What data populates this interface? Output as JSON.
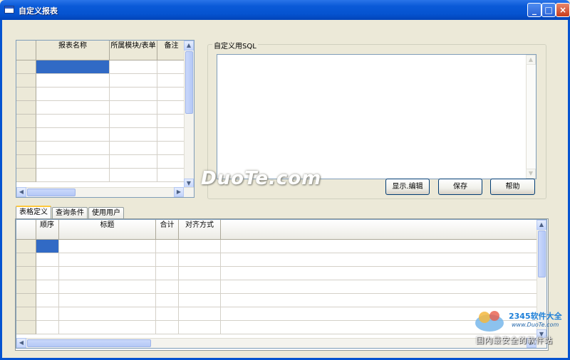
{
  "window": {
    "title": "自定义报表",
    "minimize": "_",
    "maximize": "□",
    "close": "×"
  },
  "top_grid": {
    "columns": [
      "报表名称",
      "所属模块/表单",
      "备注"
    ],
    "row_count": 9
  },
  "sql_group": {
    "legend": "自定义用SQL",
    "sql_text": ""
  },
  "buttons": {
    "display_edit": "显示.编辑",
    "save": "保存",
    "help": "帮助"
  },
  "tabs": [
    {
      "label": "表格定义",
      "active": true
    },
    {
      "label": "查询条件",
      "active": false
    },
    {
      "label": "使用用户",
      "active": false
    }
  ],
  "bottom_grid": {
    "columns": [
      "顺序",
      "标题",
      "合计",
      "对齐方式"
    ],
    "row_count": 7
  },
  "watermark": "DuoTe.com",
  "brand": {
    "logo_text": "2345软件大全",
    "url": "www.DuoTe.com",
    "slogan": "国内最安全的软件站"
  },
  "scroll_glyphs": {
    "up": "▲",
    "down": "▼",
    "left": "◀",
    "right": "▶"
  }
}
